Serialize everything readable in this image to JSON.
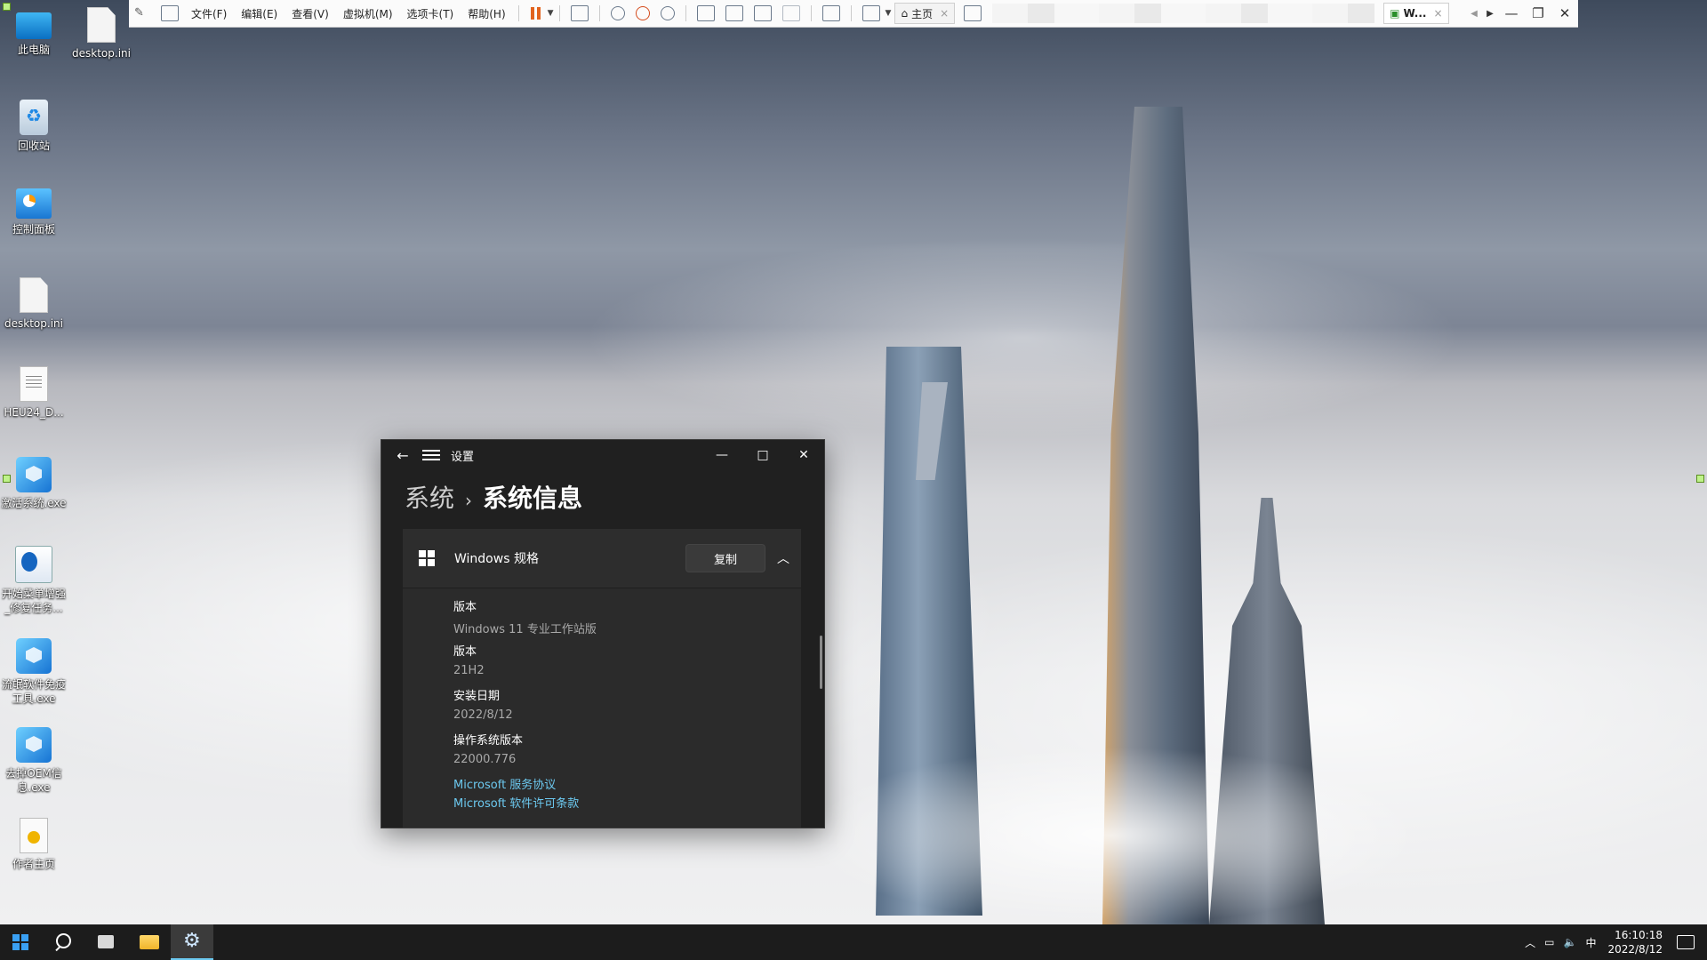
{
  "desktop": {
    "icons": [
      {
        "label": "此电脑",
        "icon": "computer-icon"
      },
      {
        "label": "desktop.ini",
        "icon": "file-icon"
      },
      {
        "label": "回收站",
        "icon": "recycle-bin-icon"
      },
      {
        "label": "控制面板",
        "icon": "control-panel-icon"
      },
      {
        "label": "desktop.ini",
        "icon": "file-icon"
      },
      {
        "label": "HEU24_D...",
        "icon": "text-file-icon"
      },
      {
        "label": "激活系统.exe",
        "icon": "cube-app-icon"
      },
      {
        "label": "开始菜单增强_修复任务...",
        "icon": "tool-app-icon"
      },
      {
        "label": "流氓软件免疫工具.exe",
        "icon": "cube-app-icon"
      },
      {
        "label": "去掉OEM信息.exe",
        "icon": "cube-app-icon"
      },
      {
        "label": "作者主页",
        "icon": "link-icon"
      }
    ]
  },
  "vmware_toolbar": {
    "menus": [
      "文件(F)",
      "编辑(E)",
      "查看(V)",
      "虚拟机(M)",
      "选项卡(T)",
      "帮助(H)"
    ],
    "home_tab": "主页",
    "vm_tab": "W...",
    "pause_color": "#e2631e"
  },
  "settings_window": {
    "app_title": "设置",
    "breadcrumb_parent": "系统",
    "breadcrumb_current": "系统信息",
    "section_title": "Windows 规格",
    "copy_button": "复制",
    "specs": [
      {
        "key": "版本",
        "value": "Windows 11 专业工作站版"
      },
      {
        "key": "版本",
        "value": "21H2"
      },
      {
        "key": "安装日期",
        "value": "2022/8/12"
      },
      {
        "key": "操作系统版本",
        "value": "22000.776"
      }
    ],
    "links": [
      "Microsoft 服务协议",
      "Microsoft 软件许可条款"
    ],
    "link_color": "#6cc9f0"
  },
  "taskbar": {
    "ime": "中",
    "time": "16:10:18",
    "date": "2022/8/12",
    "accent": "#3aa0f3"
  }
}
